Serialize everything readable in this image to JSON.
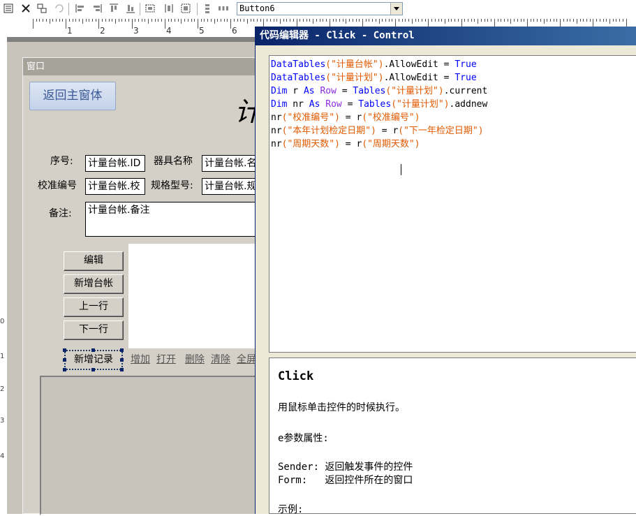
{
  "toolbar": {
    "combo_value": "Button6",
    "icons": [
      "properties-icon",
      "delete-icon",
      "copy-format-icon",
      "undo-icon",
      "align-left-icon",
      "align-right-icon",
      "align-top-icon",
      "align-bottom-icon",
      "same-size-icon",
      "same-height-icon",
      "group-icon",
      "distribute-vertical-icon",
      "distribute-horizontal-icon"
    ]
  },
  "ruler": {
    "numbers": [
      "1",
      "2",
      "3",
      "4",
      "5",
      "6"
    ]
  },
  "vruler": {
    "numbers": [
      "0",
      "1",
      "2",
      "3",
      "4"
    ]
  },
  "form": {
    "title": "窗口",
    "return_button": "返回主窗体",
    "big_title": "计",
    "labels": {
      "seq": "序号:",
      "name": "器具名称",
      "calib": "校准编号",
      "spec": "规格型号:",
      "note": "备注:"
    },
    "fields": {
      "seq": "计量台帐.ID",
      "name": "计量台帐.名",
      "calib": "计量台帐.校",
      "spec": "计量台帐.规",
      "note": "计量台帐.备注"
    },
    "buttons": {
      "edit": "编辑",
      "add_ledger": "新增台帐",
      "prev": "上一行",
      "next": "下一行",
      "new_record": "新增记录"
    },
    "links": [
      "增加",
      "打开",
      "删除",
      "清除",
      "全屏"
    ]
  },
  "editor": {
    "title": "代码编辑器 - Click - Control",
    "code": [
      [
        [
          "k",
          "DataTables"
        ],
        [
          "s",
          "(\"计量台帐\")"
        ],
        [
          "p",
          ".AllowEdit = "
        ],
        [
          "k",
          "True"
        ]
      ],
      [
        [
          "k",
          "DataTables"
        ],
        [
          "s",
          "(\"计量计划\")"
        ],
        [
          "p",
          ".AllowEdit = "
        ],
        [
          "k",
          "True"
        ]
      ],
      [
        [
          "k",
          "Dim"
        ],
        [
          "p",
          " r "
        ],
        [
          "k",
          "As"
        ],
        [
          "p",
          " "
        ],
        [
          "t",
          "Row"
        ],
        [
          "p",
          " = "
        ],
        [
          "k",
          "Tables"
        ],
        [
          "s",
          "(\"计量计划\")"
        ],
        [
          "p",
          ".current"
        ]
      ],
      [
        [
          "k",
          "Dim"
        ],
        [
          "p",
          " nr "
        ],
        [
          "k",
          "As"
        ],
        [
          "p",
          " "
        ],
        [
          "t",
          "Row"
        ],
        [
          "p",
          " = "
        ],
        [
          "k",
          "Tables"
        ],
        [
          "s",
          "(\"计量计划\")"
        ],
        [
          "p",
          ".addnew"
        ]
      ],
      [
        [
          "p",
          "nr"
        ],
        [
          "s",
          "(\"校准编号\")"
        ],
        [
          "p",
          " = r"
        ],
        [
          "s",
          "(\"校准编号\")"
        ]
      ],
      [
        [
          "p",
          "nr"
        ],
        [
          "s",
          "(\"本年计划检定日期\")"
        ],
        [
          "p",
          " = r"
        ],
        [
          "s",
          "(\"下一年检定日期\")"
        ]
      ],
      [
        [
          "p",
          "nr"
        ],
        [
          "s",
          "(\"周期天数\")"
        ],
        [
          "p",
          " = r"
        ],
        [
          "s",
          "(\"周期天数\")"
        ]
      ]
    ],
    "help": {
      "title": "Click",
      "desc": "用鼠标单击控件的时候执行。",
      "params_heading": "e参数属性:",
      "sender": "Sender: 返回触发事件的控件",
      "form": "Form:   返回控件所在的窗口",
      "example": "示例:"
    }
  },
  "colors": {
    "keyword": "#0000ff",
    "type": "#8a2be2",
    "string": "#e05a00",
    "editor_title": "#0a246a",
    "form_bg": "#d4d0c8",
    "surface": "#808080"
  }
}
